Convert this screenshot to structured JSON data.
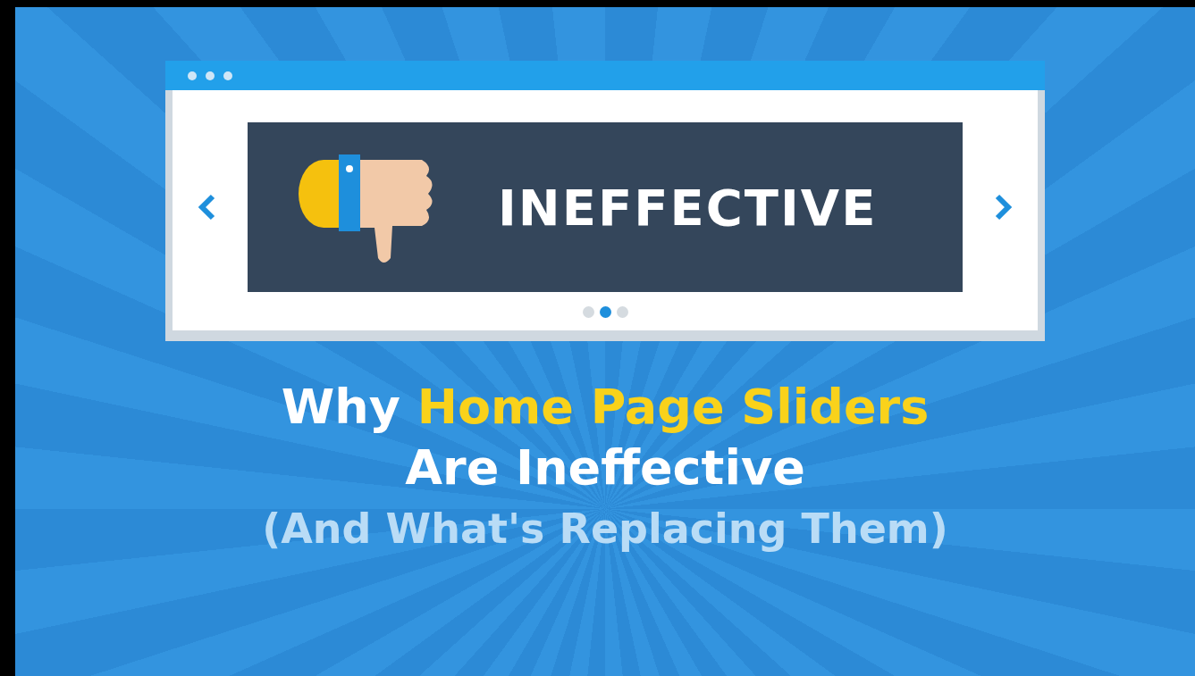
{
  "browser": {
    "slide": {
      "heading": "INEFFECTIVE"
    },
    "dots": [
      {
        "selected": false
      },
      {
        "selected": true
      },
      {
        "selected": false
      }
    ]
  },
  "title": {
    "lines": [
      {
        "segments": [
          {
            "text": "Why ",
            "highlight": false
          },
          {
            "text": "Home Page Sliders",
            "highlight": true
          }
        ]
      },
      {
        "segments": [
          {
            "text": "Are Ineffective",
            "highlight": false
          }
        ]
      }
    ],
    "subtitle": "(And What's Replacing Them)"
  }
}
